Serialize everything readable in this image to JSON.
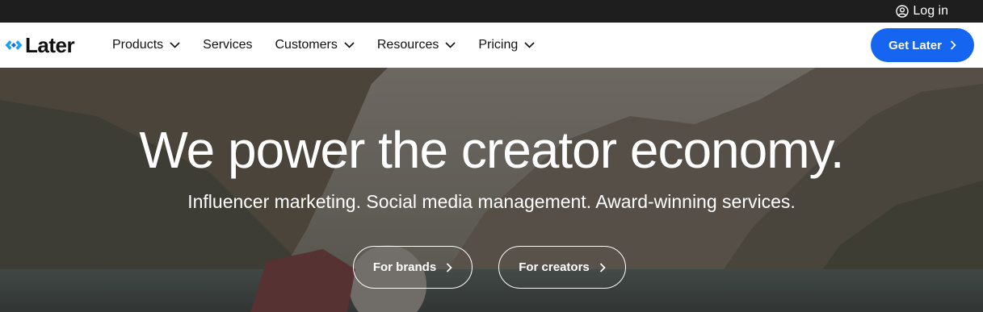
{
  "topbar": {
    "login_label": "Log in"
  },
  "brand": {
    "name": "Later",
    "accent": "#1da1f2"
  },
  "nav": {
    "items": [
      {
        "label": "Products",
        "dropdown": true
      },
      {
        "label": "Services",
        "dropdown": false
      },
      {
        "label": "Customers",
        "dropdown": true
      },
      {
        "label": "Resources",
        "dropdown": true
      },
      {
        "label": "Pricing",
        "dropdown": true
      }
    ],
    "cta_label": "Get Later",
    "cta_color": "#1565f0"
  },
  "hero": {
    "headline": "We power the creator economy.",
    "subheadline": "Influencer marketing. Social media management. Award-winning services.",
    "buttons": [
      {
        "label": "For brands"
      },
      {
        "label": "For creators"
      }
    ]
  }
}
